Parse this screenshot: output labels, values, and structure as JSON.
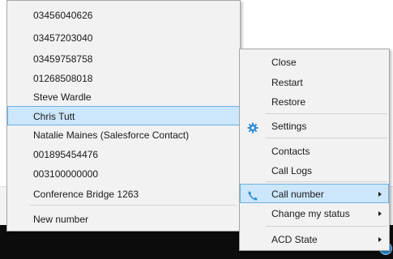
{
  "recent_numbers_menu": {
    "items": [
      "03456040626",
      "03457203040",
      "03459758758",
      "01268508018",
      "Steve Wardle",
      "Chris Tutt",
      "Natalie Maines (Salesforce Contact)",
      "001895454476",
      "003100000000",
      " Conference Bridge 1263"
    ],
    "selected_item": "Chris Tutt",
    "new_number_label": "New number"
  },
  "tray_menu": {
    "close_label": "Close",
    "restart_label": "Restart",
    "restore_label": "Restore",
    "settings_label": "Settings",
    "contacts_label": "Contacts",
    "call_logs_label": "Call Logs",
    "call_number_label": "Call number",
    "change_status_label": "Change my status",
    "acd_state_label": "ACD State",
    "accent_color": "#2b8ed8",
    "highlight_color": "#cce6fb"
  },
  "icons": {
    "settings": "gear-icon",
    "call_number": "phone-icon",
    "submenu": "chevron-right-icon",
    "tray": "tray-app-icon"
  }
}
